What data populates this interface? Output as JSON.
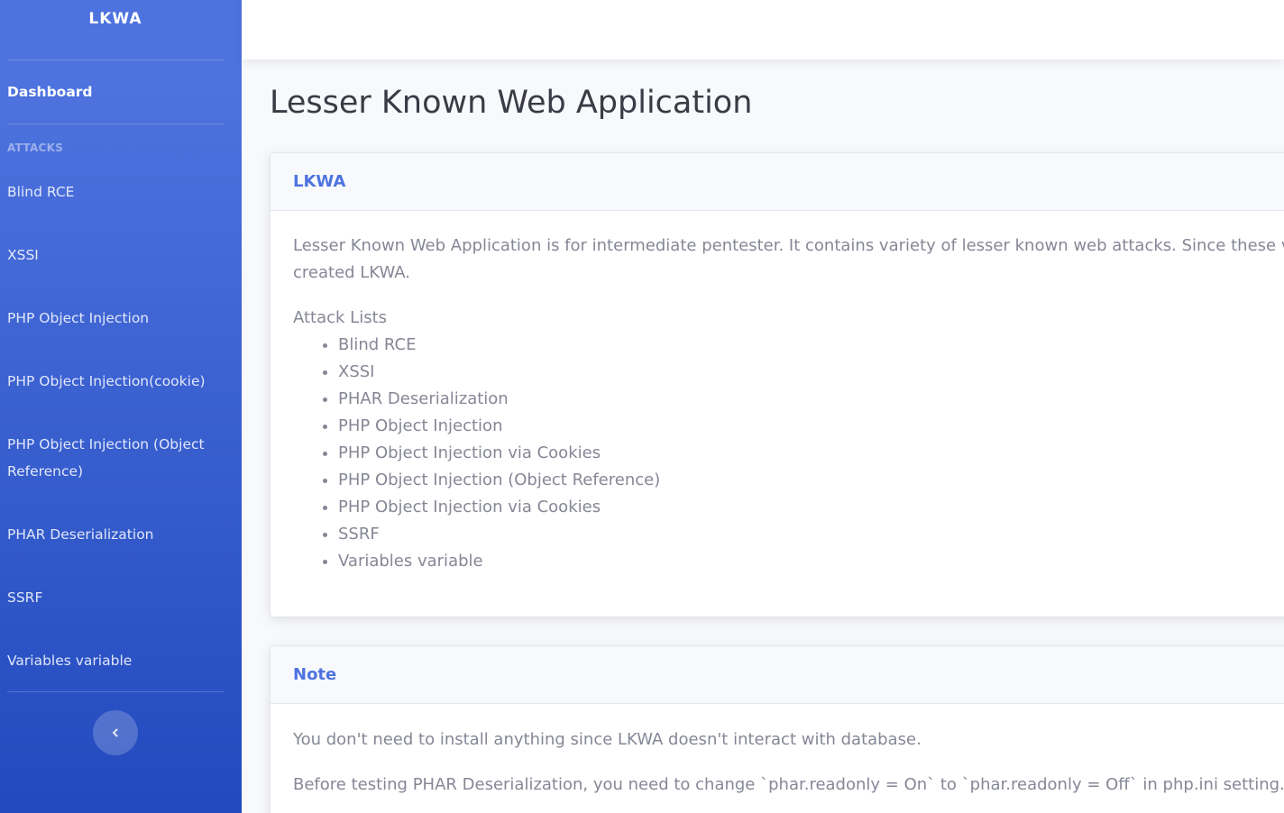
{
  "sidebar": {
    "brand": "LKWA",
    "dashboard_label": "Dashboard",
    "heading": "ATTACKS",
    "items": [
      {
        "label": "Blind RCE"
      },
      {
        "label": "XSSI"
      },
      {
        "label": "PHP Object Injection"
      },
      {
        "label": "PHP Object Injection(cookie)"
      },
      {
        "label": "PHP Object Injection (Object Reference)"
      },
      {
        "label": "PHAR Deserialization"
      },
      {
        "label": "SSRF"
      },
      {
        "label": "Variables variable"
      }
    ],
    "toggle_icon": "chevron-left-icon"
  },
  "main": {
    "title": "Lesser Known Web Application",
    "intro_card": {
      "header": "LKWA",
      "description": "Lesser Known Web Application is for intermediate pentester. It contains variety of lesser known web attacks. Since these vu",
      "description_cont": "created LKWA.",
      "list_title": "Attack Lists",
      "attacks": [
        "Blind RCE",
        "XSSI",
        "PHAR Deserialization",
        "PHP Object Injection",
        "PHP Object Injection via Cookies",
        "PHP Object Injection (Object Reference)",
        "PHP Object Injection via Cookies",
        "SSRF",
        "Variables variable"
      ]
    },
    "note_card": {
      "header": "Note",
      "line1": "You don't need to install anything since LKWA doesn't interact with database.",
      "line2": "Before testing PHAR Deserialization, you need to change `phar.readonly = On` to `phar.readonly = Off` in php.ini setting."
    }
  },
  "colors": {
    "primary": "#4e73df",
    "sidebar_end": "#224abe",
    "text_gray": "#858796",
    "title": "#3a3b45"
  }
}
